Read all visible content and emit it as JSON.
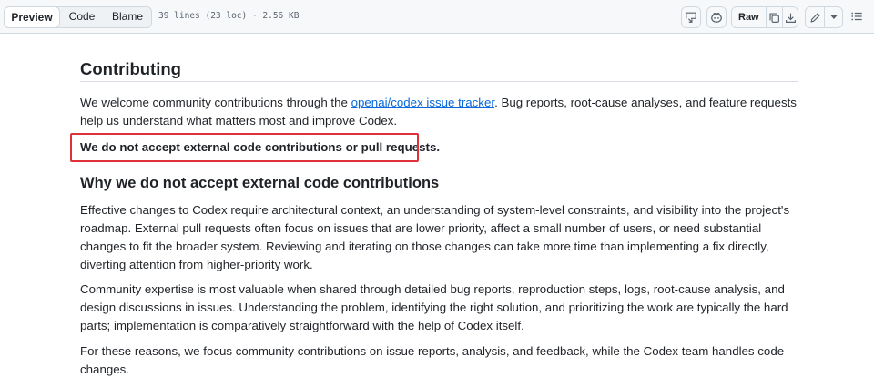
{
  "toolbar": {
    "tabs": [
      {
        "label": "Preview",
        "active": true
      },
      {
        "label": "Code",
        "active": false
      },
      {
        "label": "Blame",
        "active": false
      }
    ],
    "meta": "39 lines (23 loc) · 2.56 KB",
    "raw_label": "Raw",
    "icons": [
      "open-in-codespace-icon",
      "copilot-icon",
      "copy-icon",
      "download-icon",
      "pencil-icon",
      "triangle-down-icon",
      "list-unordered-icon"
    ]
  },
  "document": {
    "title": "Contributing",
    "intro_before_link": "We welcome community contributions through the ",
    "intro_link": "openai/codex issue tracker",
    "intro_after_link": ". Bug reports, root-cause analyses, and feature requests help us understand what matters most and improve Codex.",
    "policy": "We do not accept external code contributions or pull requests.",
    "section_heading": "Why we do not accept external code contributions",
    "para1": "Effective changes to Codex require architectural context, an understanding of system-level constraints, and visibility into the project's roadmap. External pull requests often focus on issues that are lower priority, affect a small number of users, or need substantial changes to fit the broader system. Reviewing and iterating on those changes can take more time than implementing a fix directly, diverting attention from higher-priority work.",
    "para2": "Community expertise is most valuable when shared through detailed bug reports, reproduction steps, logs, root-cause analysis, and design discussions in issues. Understanding the problem, identifying the right solution, and prioritizing the work are typically the hard parts; implementation is comparatively straightforward with the help of Codex itself.",
    "para3": "For these reasons, we focus community contributions on issue reports, analysis, and feedback, while the Codex team handles code changes."
  },
  "colors": {
    "link": "#0969da",
    "highlight_border": "#e0303a",
    "toolbar_bg": "#f6f8fa"
  }
}
